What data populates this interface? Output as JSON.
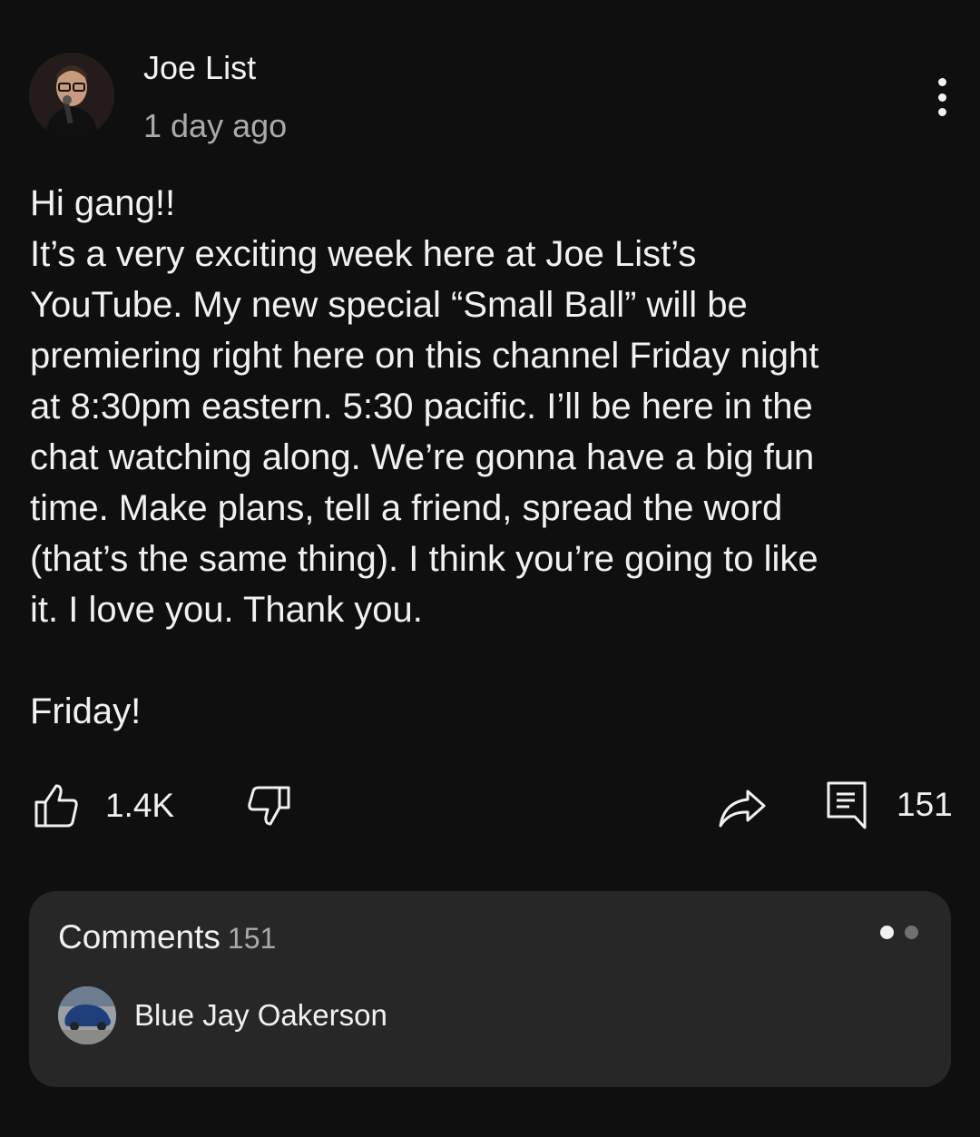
{
  "post": {
    "author": "Joe List",
    "time": "1 day ago",
    "body": "Hi gang!!\nIt’s a very exciting week here at Joe List’s\nYouTube. My new special “Small Ball” will be\npremiering right here on this channel Friday night\nat 8:30pm eastern. 5:30 pacific. I’ll be here in the\nchat watching along. We’re gonna have a big fun\ntime. Make plans, tell a friend, spread the word\n(that’s the same thing). I think you’re going to like\nit. I love you. Thank you.\n\nFriday!"
  },
  "actions": {
    "likes": "1.4K",
    "comments": "151"
  },
  "comments_card": {
    "title": "Comments",
    "count": "151",
    "pager": {
      "total": 2,
      "active": 1
    },
    "first_commenter": "Blue Jay Oakerson"
  },
  "icons": {
    "menu": "more-vertical-icon",
    "like": "thumbs-up-icon",
    "dislike": "thumbs-down-icon",
    "share": "share-arrow-icon",
    "comment": "comment-icon"
  },
  "colors": {
    "background": "#0f0f0f",
    "card": "#272727",
    "text": "#f1f1f1",
    "secondary_text": "#aaaaaa"
  }
}
